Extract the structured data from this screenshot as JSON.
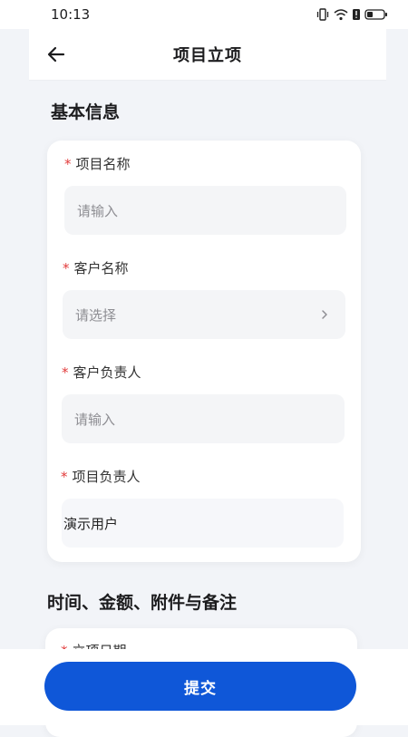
{
  "status_bar": {
    "time": "10:13"
  },
  "nav": {
    "title": "项目立项"
  },
  "sections": {
    "basic": "基本信息",
    "time": "时间、金额、附件与备注"
  },
  "fields": [
    {
      "required": "*",
      "label": "项目名称",
      "value": "",
      "placeholder": "请输入"
    },
    {
      "required": "*",
      "label": "客户名称",
      "value": "",
      "placeholder": "请选择"
    },
    {
      "required": "*",
      "label": "客户负责人",
      "value": "",
      "placeholder": "请输入"
    },
    {
      "required": "*",
      "label": "项目负责人",
      "value": "演示用户",
      "placeholder": ""
    }
  ],
  "partial_field": {
    "required": "*",
    "label": "立项日期"
  },
  "submit": {
    "label": "提交"
  },
  "colors": {
    "primary": "#0f57d8",
    "required": "#e23b3b",
    "page_bg": "#f2f4f8"
  }
}
